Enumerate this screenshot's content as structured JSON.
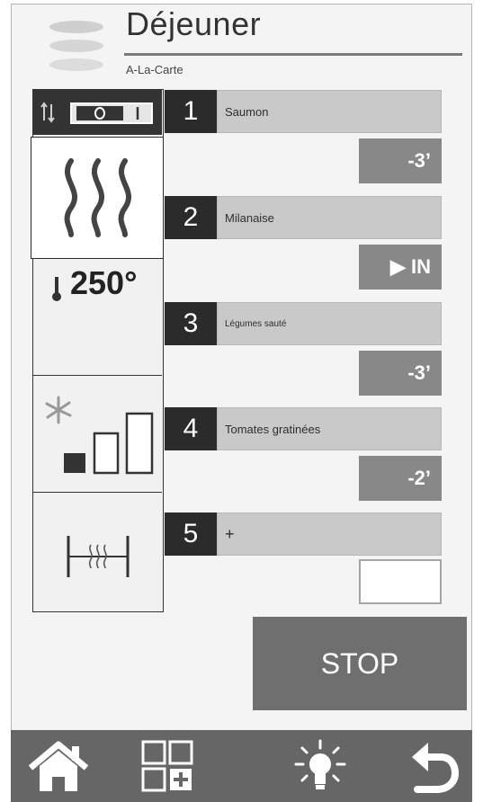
{
  "header": {
    "title": "Déjeuner",
    "subtitle": "A-La-Carte",
    "icon": "stacked-plates-icon"
  },
  "left_panel": {
    "switch": {
      "icon": "switch-toggle-icon",
      "state_on": "I",
      "state_off": "O"
    },
    "mode": {
      "icon": "steam-heat-icon"
    },
    "temperature": {
      "icon": "thermometer-icon",
      "value": "250°"
    },
    "fan": {
      "icon": "fan-icon",
      "level_bars": 3,
      "active_bars": 1
    },
    "rack": {
      "icon": "rack-level-icon"
    }
  },
  "programs": [
    {
      "number": "1",
      "name": "Saumon",
      "time": "-3’",
      "time_style": "gray"
    },
    {
      "number": "2",
      "name": "Milanaise",
      "time": "▶ IN",
      "time_style": "gray"
    },
    {
      "number": "3",
      "name": "Légumes sauté",
      "time": "-3’",
      "time_style": "gray"
    },
    {
      "number": "4",
      "name": "Tomates gratinées",
      "time": "-2’",
      "time_style": "gray"
    },
    {
      "number": "5",
      "name": "+",
      "time": "",
      "time_style": "empty"
    }
  ],
  "actions": {
    "stop_label": "STOP"
  },
  "nav": [
    {
      "name": "home-icon"
    },
    {
      "name": "program-grid-add-icon"
    },
    {
      "name": "light-bulb-icon"
    },
    {
      "name": "undo-arrow-icon"
    }
  ],
  "colors": {
    "dark": "#2b2b2b",
    "name_bar": "#c9c9c9",
    "time_box": "#888888",
    "stop_button": "#6f6f6f",
    "nav_bar": "#666666"
  }
}
